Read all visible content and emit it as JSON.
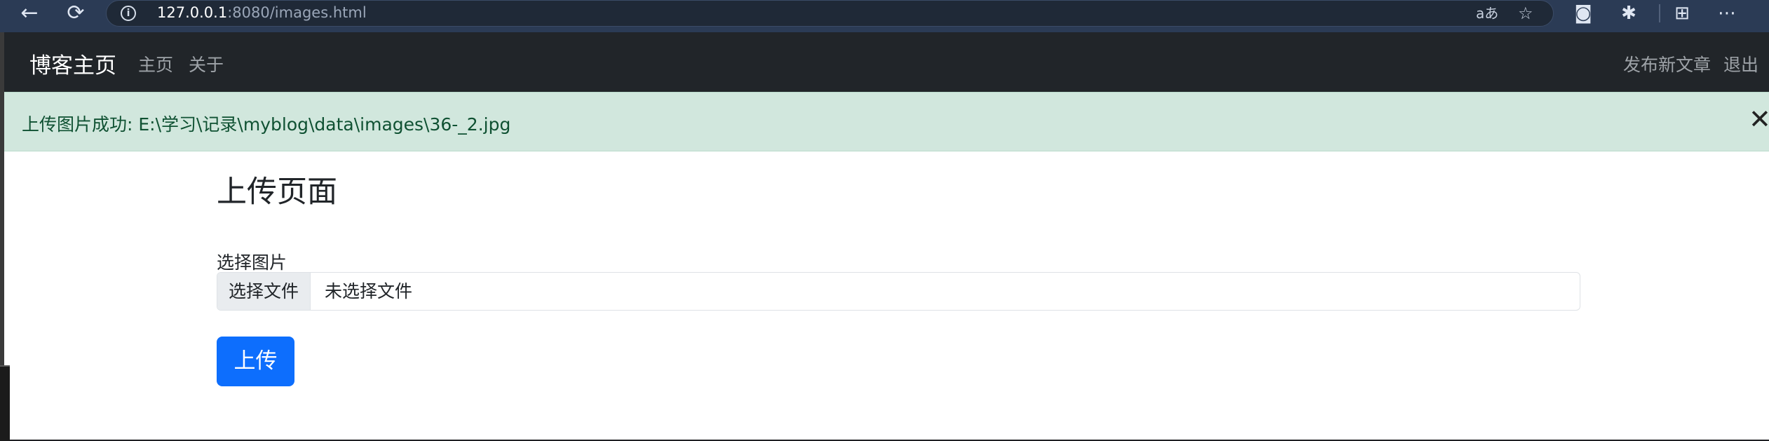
{
  "browser": {
    "url_host": "127.0.0.1",
    "url_rest": ":8080/images.html",
    "read_aloud_label": "aあ",
    "icons": {
      "back": "back-arrow-icon",
      "reload": "reload-icon",
      "info": "site-info-icon",
      "favorite": "star-icon",
      "profile": "profile-icon",
      "extensions": "extensions-icon",
      "collections": "collections-icon",
      "menu": "more-menu-icon"
    }
  },
  "navbar": {
    "brand": "博客主页",
    "links": [
      "主页",
      "关于"
    ],
    "right_links": [
      "发布新文章",
      "退出"
    ]
  },
  "alert": {
    "message": "上传图片成功: E:\\学习\\记录\\myblog\\data\\images\\36-_2.jpg",
    "close_symbol": "✕",
    "color": "#d1e7dd"
  },
  "form": {
    "title": "上传页面",
    "label": "选择图片",
    "file_button": "选择文件",
    "file_status": "未选择文件",
    "submit": "上传",
    "submit_color": "#0d6efd"
  }
}
